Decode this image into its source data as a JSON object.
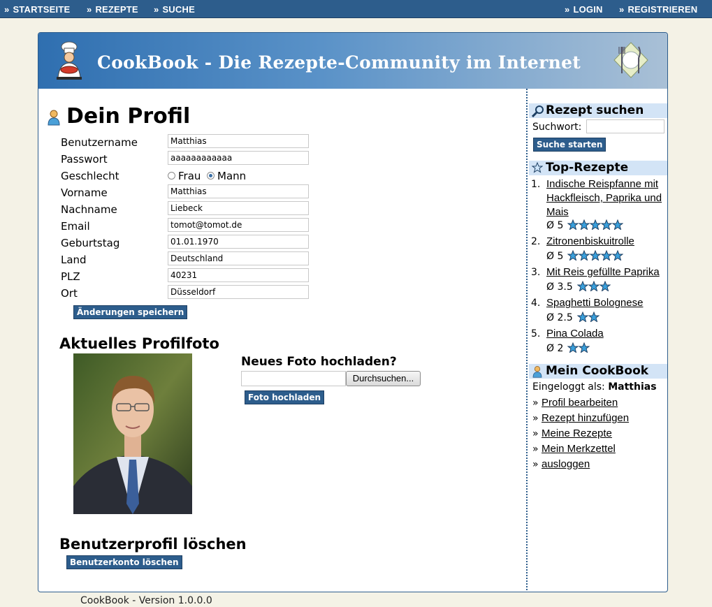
{
  "topnav": {
    "arrow": "»",
    "startseite": "STARTSEITE",
    "rezepte": "REZEPTE",
    "suche": "SUCHE",
    "login": "LOGIN",
    "registrieren": "REGISTRIEREN"
  },
  "banner": {
    "title": "CookBook - Die Rezepte-Community im Internet"
  },
  "profile": {
    "heading": "Dein Profil",
    "fields": [
      {
        "label": "Benutzername",
        "value": "Matthias"
      },
      {
        "label": "Passwort",
        "value": "aaaaaaaaaaaa"
      },
      {
        "label": "Geschlecht",
        "value": "Mann"
      },
      {
        "label": "Vorname",
        "value": "Matthias"
      },
      {
        "label": "Nachname",
        "value": "Liebeck"
      },
      {
        "label": "Email",
        "value": "tomot@tomot.de"
      },
      {
        "label": "Geburtstag",
        "value": "01.01.1970"
      },
      {
        "label": "Land",
        "value": "Deutschland"
      },
      {
        "label": "PLZ",
        "value": "40231"
      },
      {
        "label": "Ort",
        "value": "Düsseldorf"
      }
    ],
    "gender_options": [
      "Frau",
      "Mann"
    ],
    "save_button": "Änderungen speichern"
  },
  "photo": {
    "heading": "Aktuelles Profilfoto",
    "upload_heading": "Neues Foto hochladen?",
    "browse_button": "Durchsuchen...",
    "upload_button": "Foto hochladen"
  },
  "delete": {
    "heading": "Benutzerprofil löschen",
    "button": "Benutzerkonto löschen"
  },
  "sidebar": {
    "search": {
      "heading": "Rezept suchen",
      "label": "Suchwort:",
      "button": "Suche starten"
    },
    "top": {
      "heading": "Top-Rezepte",
      "items": [
        {
          "num": "1.",
          "line1": "Indische Reispfanne mit",
          "line2": "Hackfleisch, Paprika und",
          "line3": "Mais",
          "rating": "Ø 5",
          "stars": 5
        },
        {
          "num": "2.",
          "line1": "Zitronenbiskuitrolle",
          "rating": "Ø 5",
          "stars": 5
        },
        {
          "num": "3.",
          "line1": "Mit Reis gefüllte Paprika",
          "rating": "Ø 3.5",
          "stars": 3
        },
        {
          "num": "4.",
          "line1": "Spaghetti Bolognese",
          "rating": "Ø 2.5",
          "stars": 2
        },
        {
          "num": "5.",
          "line1": "Pina Colada",
          "rating": "Ø 2",
          "stars": 2
        }
      ]
    },
    "mein": {
      "heading": "Mein CookBook",
      "logged_label": "Eingeloggt als:",
      "logged_user": "Matthias",
      "bullet": "»",
      "links": [
        "Profil bearbeiten",
        "Rezept hinzufügen",
        "Meine Rezepte",
        "Mein Merkzettel",
        "ausloggen"
      ]
    }
  },
  "footer": "CookBook - Version 1.0.0.0",
  "colors": {
    "nav": "#2d5d8c",
    "sidebar_head": "#d3e4f6",
    "star": "#3aa0dc"
  }
}
